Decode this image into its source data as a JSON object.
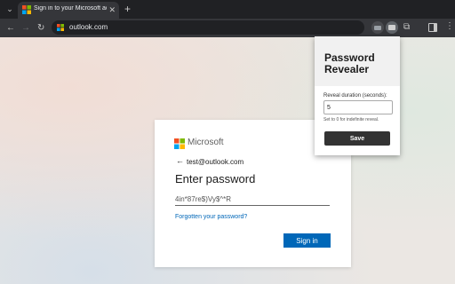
{
  "browser": {
    "tab_title": "Sign in to your Microsoft accou",
    "tab_close_glyph": "✕",
    "new_tab_glyph": "+",
    "address_url": "outlook.com",
    "window_controls": {
      "minimize": "—",
      "maximize": "☐",
      "close": "✕"
    }
  },
  "login": {
    "brand": "Microsoft",
    "email": "test@outlook.com",
    "heading": "Enter password",
    "password_value": "4in*87re$)Vy$^*R",
    "forgot_link": "Forgotten your password?",
    "signin_button": "Sign in"
  },
  "popup": {
    "title": "Password Revealer",
    "duration_label": "Reveal duration (seconds):",
    "duration_value": "5",
    "hint": "Set to 0 for indefinite reveal.",
    "save_button": "Save"
  },
  "colors": {
    "accent_blue": "#0067b8",
    "browser_dark": "#202124",
    "toolbar": "#35363a",
    "ms_red": "#f25022",
    "ms_green": "#7fba00",
    "ms_blue": "#00a4ef",
    "ms_yellow": "#ffb900"
  },
  "icons": {
    "back": "arrow-left-icon",
    "forward": "arrow-right-icon",
    "reload": "reload-icon",
    "extensions": "puzzle-icon",
    "menu": "kebab-menu-icon"
  }
}
